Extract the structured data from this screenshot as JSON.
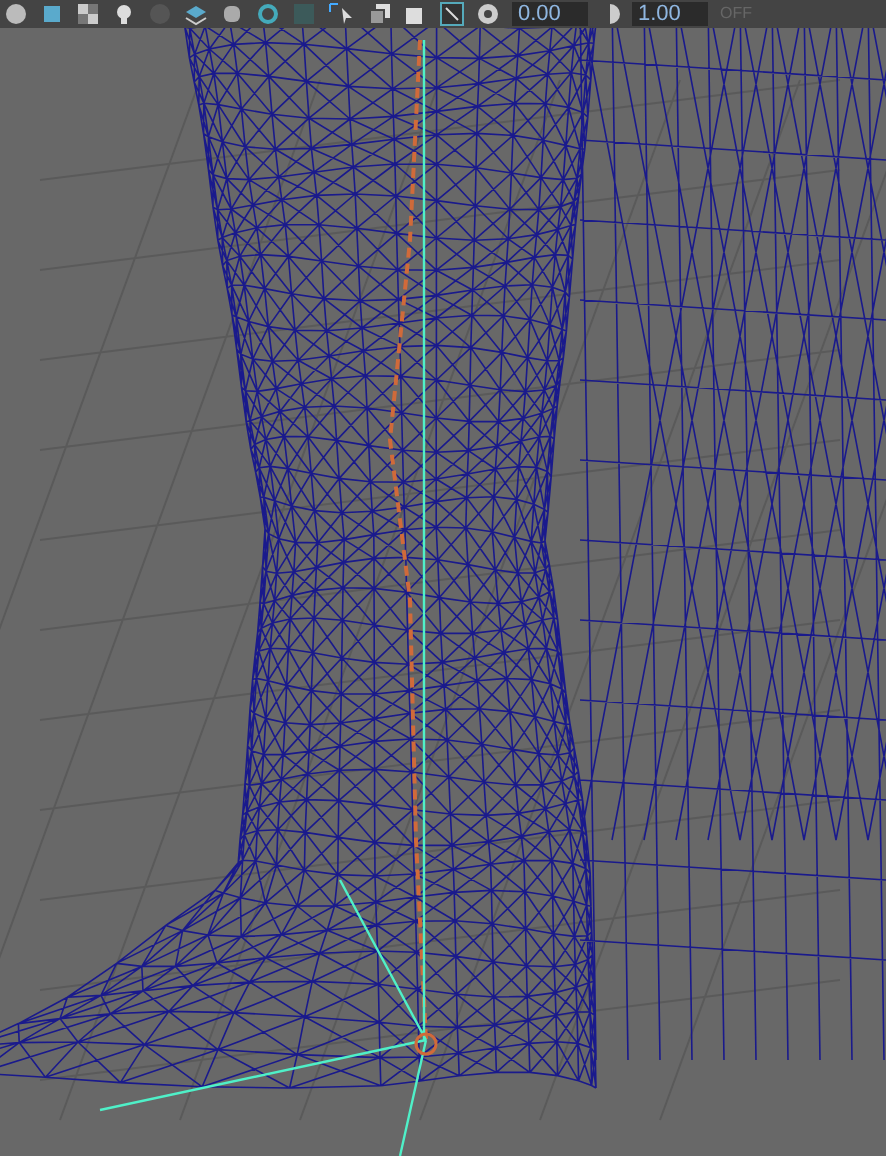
{
  "toolbar": {
    "fields": [
      {
        "value": "0.00"
      },
      {
        "value": "1.00"
      }
    ],
    "toggle": {
      "label": "OFF"
    }
  }
}
